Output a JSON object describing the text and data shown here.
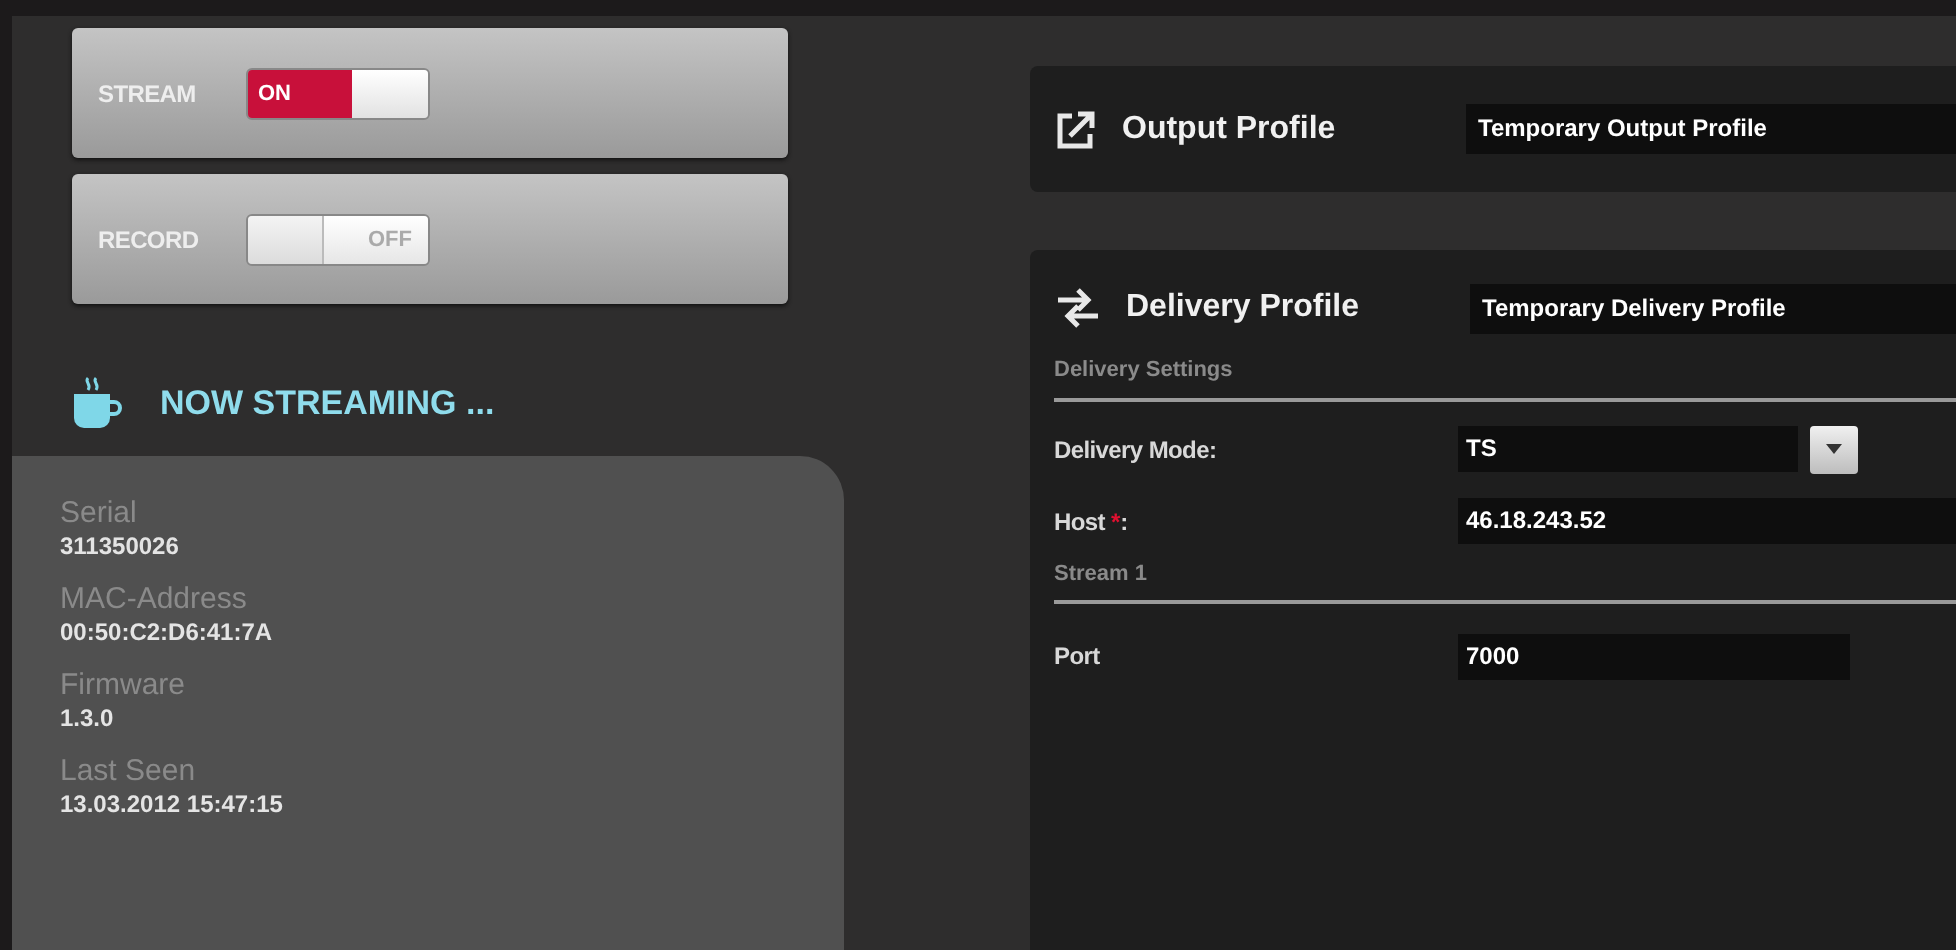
{
  "toggles": [
    {
      "label": "STREAM",
      "on": true,
      "state_text": "ON"
    },
    {
      "label": "RECORD",
      "on": false,
      "state_text": "OFF"
    }
  ],
  "status": "NOW STREAMING ...",
  "info": [
    {
      "label": "Serial",
      "value": "311350026"
    },
    {
      "label": "MAC-Address",
      "value": "00:50:C2:D6:41:7A"
    },
    {
      "label": "Firmware",
      "value": "1.3.0"
    },
    {
      "label": "Last Seen",
      "value": "13.03.2012 15:47:15"
    }
  ],
  "output_profile": {
    "title": "Output Profile",
    "value": "Temporary Output Profile"
  },
  "delivery_profile": {
    "title": "Delivery Profile",
    "value": "Temporary Delivery Profile",
    "section": "Delivery Settings",
    "fields": [
      {
        "kind": "select",
        "label": "Delivery Mode:",
        "value": "TS"
      },
      {
        "kind": "text",
        "label": "Host",
        "required_mark": "*",
        "label_end": ":",
        "value": "46.18.243.52"
      }
    ],
    "stream_section": "Stream 1",
    "stream_fields": [
      {
        "kind": "short",
        "label": "Port",
        "value": "7000"
      }
    ]
  }
}
